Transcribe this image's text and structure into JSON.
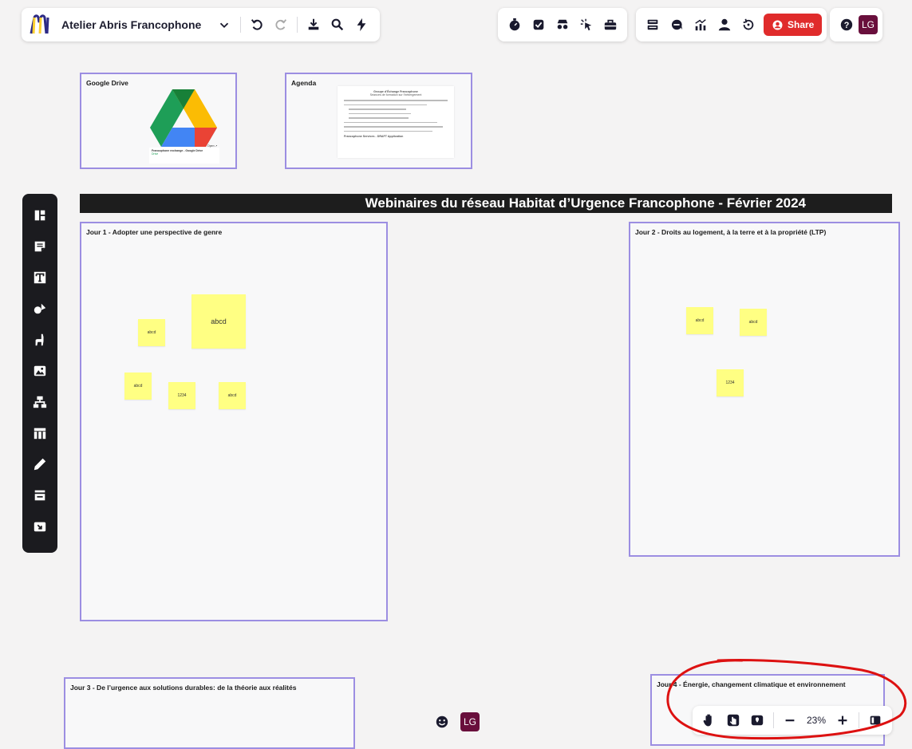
{
  "topbar": {
    "board_title": "Atelier Abris Francophone",
    "icons": [
      "miro-logo",
      "chevron-down-icon",
      "undo-icon",
      "redo-icon",
      "export-icon",
      "search-icon",
      "lightning-icon"
    ]
  },
  "collab_tools": {
    "group_a": [
      "timer-icon",
      "voting-icon",
      "spy-icon",
      "cursor-icon",
      "toolbox-icon"
    ],
    "group_b": [
      "list-icon",
      "comment-icon",
      "activity-icon",
      "user-icon",
      "history-icon"
    ],
    "share_label": "Share",
    "help_icon": "help-icon",
    "user_initials": "LG"
  },
  "left_toolbar": [
    "frames-icon",
    "sticky-note-icon",
    "text-icon",
    "shapes-icon",
    "llama-icon",
    "image-icon",
    "mindmap-icon",
    "table-icon",
    "pen-icon",
    "kanban-icon",
    "upload-icon"
  ],
  "frames": {
    "google_drive": {
      "title": "Google Drive",
      "card_title": "Francophone exchange - Google Drive",
      "card_subtitle": "Drive",
      "card_tag": "Open ↗"
    },
    "agenda": {
      "title": "Agenda",
      "doc_heading": "Groupe d’Échange Francophone",
      "doc_subheading": "Séances de formation sur l’hébergement",
      "doc_footer": "Francophone Services - DRAFT Application"
    },
    "day1": {
      "title": "Jour 1 - Adopter une perspective de genre"
    },
    "day2": {
      "title": "Jour 2 - Droits au logement, à la terre et à la propriété (LTP)"
    },
    "day3": {
      "title": "Jour 3 - De l’urgence aux solutions durables: de la théorie aux réalités"
    },
    "day4": {
      "title": "Jour 4 - Énergie, changement climatique et environnement"
    }
  },
  "banner": {
    "text": "Webinaires du réseau Habitat d’Urgence Francophone - Février 2024"
  },
  "stickies": {
    "day1": [
      "abcd",
      "abcd",
      "abcd",
      "1234",
      "abcd"
    ],
    "day2": [
      "abcd",
      "abcd",
      "1234"
    ]
  },
  "bottom": {
    "reaction_icon": "emoji-icon",
    "user_initials": "LG",
    "zoom_level": "23%",
    "tools": [
      "hand-icon",
      "hand-pointer-icon",
      "map-icon",
      "zoom-out-icon",
      "zoom-in-icon",
      "minimap-icon"
    ]
  },
  "colors": {
    "frame_border": "#9c8ee2",
    "sticky": "#ffff83",
    "share": "#e02b2b",
    "avatar": "#690f3c",
    "annotation": "#dd1111"
  }
}
